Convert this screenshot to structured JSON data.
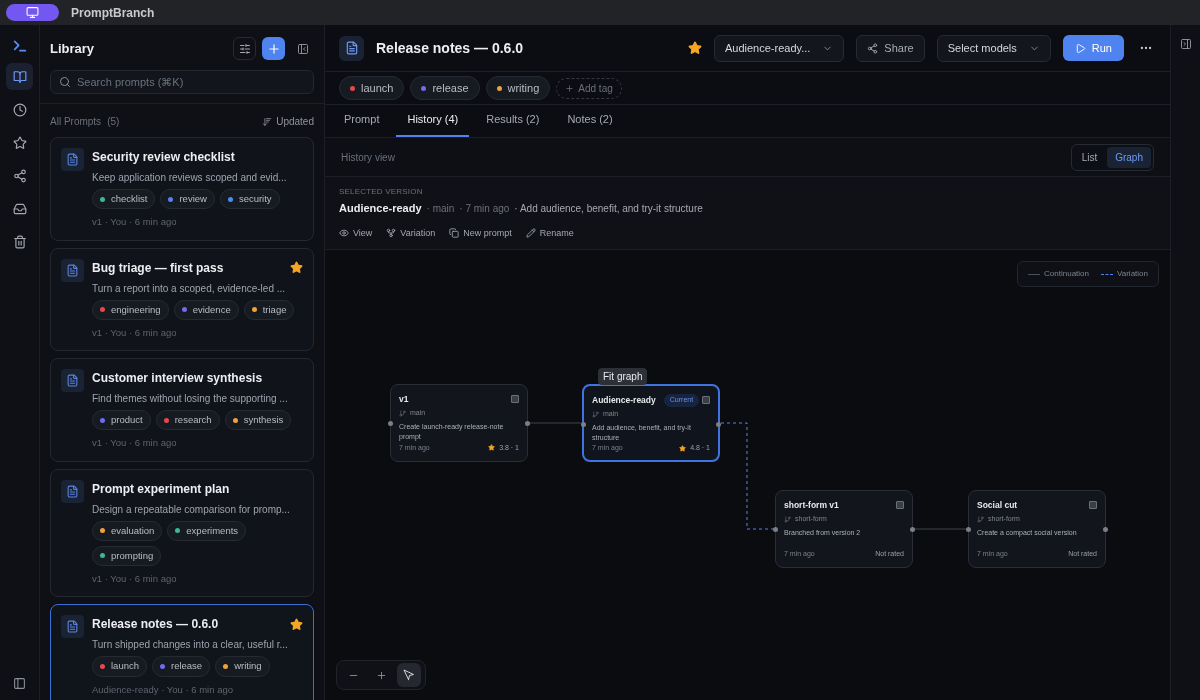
{
  "app": {
    "title": "PromptBranch"
  },
  "rail": [
    {
      "selected": true
    },
    {
      "selected": false
    },
    {
      "selected": false
    },
    {
      "selected": false
    },
    {
      "selected": false
    },
    {
      "selected": false
    }
  ],
  "library": {
    "title": "Library",
    "search": {
      "placeholder": "Search prompts (⌘K)"
    },
    "section": "All Prompts",
    "count": "(5)",
    "sort": "Updated",
    "prompts": [
      {
        "title": "Security review checklist",
        "description": "Keep application reviews scoped and evid...",
        "starred": false,
        "selected": false,
        "tags": [
          {
            "label": "checklist",
            "color": "#3fb69c"
          },
          {
            "label": "review",
            "color": "#5b7ff0"
          },
          {
            "label": "security",
            "color": "#4a8cf0"
          }
        ],
        "meta": "v1 · You · 6 min ago"
      },
      {
        "title": "Bug triage — first pass",
        "description": "Turn a report into a scoped, evidence-led ...",
        "starred": true,
        "selected": false,
        "tags": [
          {
            "label": "engineering",
            "color": "#e5484d"
          },
          {
            "label": "evidence",
            "color": "#6f6cf0"
          },
          {
            "label": "triage",
            "color": "#f0a03c"
          }
        ],
        "meta": "v1 · You · 6 min ago"
      },
      {
        "title": "Customer interview synthesis",
        "description": "Find themes without losing the supporting ...",
        "starred": false,
        "selected": false,
        "tags": [
          {
            "label": "product",
            "color": "#6f6cf0"
          },
          {
            "label": "research",
            "color": "#e5484d"
          },
          {
            "label": "synthesis",
            "color": "#f0a03c"
          }
        ],
        "meta": "v1 · You · 6 min ago"
      },
      {
        "title": "Prompt experiment plan",
        "description": "Design a repeatable comparison for promp...",
        "starred": false,
        "selected": false,
        "tags": [
          {
            "label": "evaluation",
            "color": "#f0a03c"
          },
          {
            "label": "experiments",
            "color": "#3fb69c"
          },
          {
            "label": "prompting",
            "color": "#3fb69c"
          }
        ],
        "meta": "v1 · You · 6 min ago"
      },
      {
        "title": "Release notes — 0.6.0",
        "description": "Turn shipped changes into a clear, useful r...",
        "starred": true,
        "selected": true,
        "tags": [
          {
            "label": "launch",
            "color": "#e5484d"
          },
          {
            "label": "release",
            "color": "#6f6cf0"
          },
          {
            "label": "writing",
            "color": "#f0a03c"
          }
        ],
        "meta": "Audience-ready · You · 6 min ago"
      }
    ]
  },
  "document": {
    "title": "Release notes — 0.6.0",
    "starred": true,
    "version": "Audience-ready...",
    "share": "Share",
    "models": "Select models",
    "run": "Run",
    "tags": [
      {
        "label": "launch",
        "color": "#e5484d"
      },
      {
        "label": "release",
        "color": "#6f6cf0"
      },
      {
        "label": "writing",
        "color": "#f0a03c"
      }
    ],
    "add_tag": "Add tag",
    "tabs": [
      {
        "label": "Prompt",
        "selected": false
      },
      {
        "label": "History (4)",
        "selected": true
      },
      {
        "label": "Results (2)",
        "selected": false
      },
      {
        "label": "Notes (2)",
        "selected": false
      }
    ],
    "history_view": "History view",
    "view_toggle": [
      {
        "label": "List",
        "selected": false
      },
      {
        "label": "Graph",
        "selected": true
      }
    ],
    "selected_version": {
      "heading": "SELECTED VERSION",
      "name": "Audience-ready",
      "branch": "· main",
      "time": "· 7 min ago",
      "message": "· Add audience, benefit, and try-it structure"
    },
    "actions": [
      {
        "label": "View"
      },
      {
        "label": "Variation"
      },
      {
        "label": "New prompt"
      },
      {
        "label": "Rename"
      }
    ]
  },
  "graph": {
    "legend": [
      {
        "label": "Continuation",
        "kind": "solid"
      },
      {
        "label": "Variation",
        "kind": "dashed"
      }
    ],
    "tooltip": "Fit graph",
    "nodes": [
      {
        "title": "v1",
        "branch": "main",
        "text": "Create launch-ready release-note prompt",
        "time": "7 min ago",
        "rated": true,
        "rating": "3.8 · 1",
        "selected": false,
        "checked": false
      },
      {
        "title": "Audience-ready",
        "badge": "Current",
        "branch": "main",
        "text": "Add audience, benefit, and try-it structure",
        "time": "7 min ago",
        "rated": true,
        "rating": "4.8 · 1",
        "selected": true,
        "checked": false
      },
      {
        "title": "short-form v1",
        "branch": "short-form",
        "text": "Branched from version 2",
        "time": "7 min ago",
        "rated": false,
        "rating": "Not rated",
        "selected": false,
        "checked": false
      },
      {
        "title": "Social cut",
        "branch": "short-form",
        "text": "Create a compact social version",
        "time": "7 min ago",
        "rated": false,
        "rating": "Not rated",
        "selected": false,
        "checked": false
      }
    ]
  }
}
